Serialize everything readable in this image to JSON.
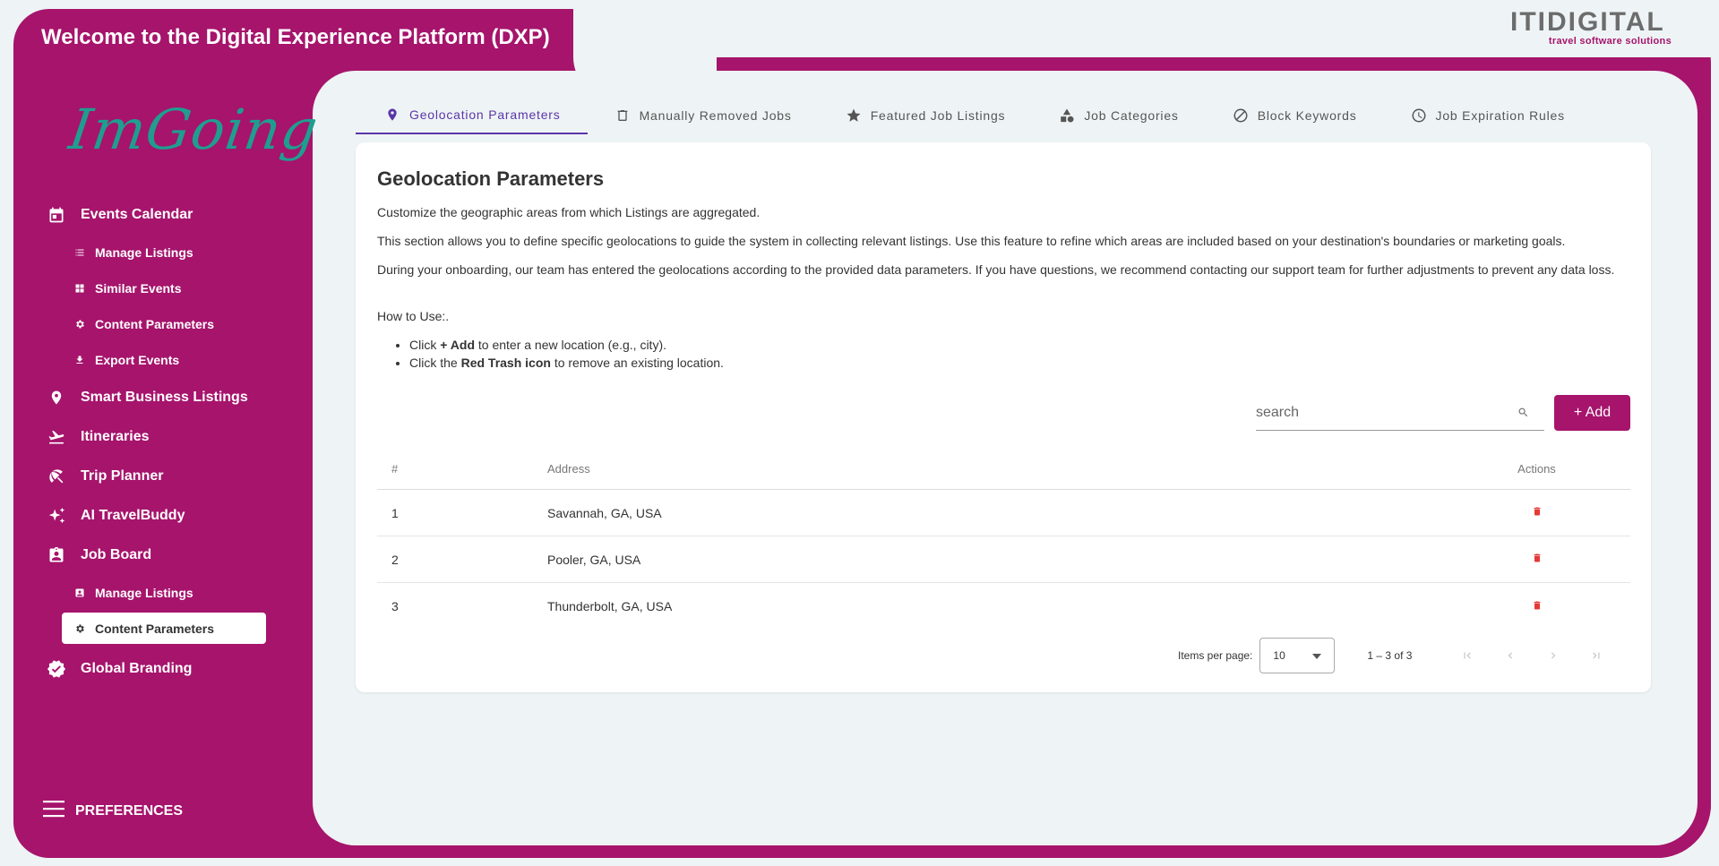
{
  "header": {
    "welcome": "Welcome to the Digital Experience Platform (DXP)"
  },
  "brand": {
    "name": "ITIDIGITAL",
    "tagline": "travel software solutions"
  },
  "sidebar": {
    "logo_text": "ImGoing",
    "items": [
      {
        "label": "Events Calendar",
        "icon": "calendar-icon"
      },
      {
        "label": "Manage Listings",
        "icon": "list-icon",
        "sub": true
      },
      {
        "label": "Similar Events",
        "icon": "similar-icon",
        "sub": true
      },
      {
        "label": "Content Parameters",
        "icon": "gear-icon",
        "sub": true
      },
      {
        "label": "Export Events",
        "icon": "download-icon",
        "sub": true
      },
      {
        "label": "Smart Business Listings",
        "icon": "pin-icon"
      },
      {
        "label": "Itineraries",
        "icon": "plane-icon"
      },
      {
        "label": "Trip Planner",
        "icon": "umbrella-icon"
      },
      {
        "label": "AI TravelBuddy",
        "icon": "sparkle-icon"
      },
      {
        "label": "Job Board",
        "icon": "badge-icon"
      },
      {
        "label": "Manage Listings",
        "icon": "list-icon",
        "sub": true
      },
      {
        "label": "Content Parameters",
        "icon": "gear-icon",
        "sub": true,
        "active": true
      },
      {
        "label": "Global Branding",
        "icon": "verified-icon"
      }
    ],
    "preferences": "PREFERENCES"
  },
  "tabs": [
    {
      "label": "Geolocation Parameters",
      "icon": "pin-icon",
      "active": true
    },
    {
      "label": "Manually Removed Jobs",
      "icon": "trash-icon"
    },
    {
      "label": "Featured Job Listings",
      "icon": "star-icon"
    },
    {
      "label": "Job Categories",
      "icon": "shapes-icon"
    },
    {
      "label": "Block Keywords",
      "icon": "block-icon"
    },
    {
      "label": "Job Expiration Rules",
      "icon": "clock-icon"
    }
  ],
  "content": {
    "title": "Geolocation Parameters",
    "p1": "Customize the geographic areas from which Listings are aggregated.",
    "p2": "This section allows you to define specific geolocations to guide the system in collecting relevant listings. Use this feature to refine which areas are included based on your destination's boundaries or marketing goals.",
    "p3": "During your onboarding, our team has entered the geolocations according to the provided data parameters. If you have questions, we recommend contacting our support team for further adjustments to prevent any data loss.",
    "how_to": "How to Use:.",
    "step1_pre": "Click ",
    "step1_bold": "+ Add",
    "step1_post": " to enter a new location (e.g., city).",
    "step2_pre": "Click the ",
    "step2_bold": "Red Trash icon",
    "step2_post": " to remove an existing location."
  },
  "search": {
    "placeholder": "search"
  },
  "add_button": "+ Add",
  "table": {
    "headers": [
      "#",
      "Address",
      "Actions"
    ],
    "rows": [
      {
        "num": "1",
        "address": "Savannah, GA, USA"
      },
      {
        "num": "2",
        "address": "Pooler, GA, USA"
      },
      {
        "num": "3",
        "address": "Thunderbolt, GA, USA"
      }
    ]
  },
  "pagination": {
    "label": "Items per page:",
    "page_size": "10",
    "range": "1 – 3 of 3"
  },
  "colors": {
    "primary": "#a6146c",
    "accent": "#5b35a8",
    "danger": "#e53935",
    "logo": "#1f9e8f"
  }
}
